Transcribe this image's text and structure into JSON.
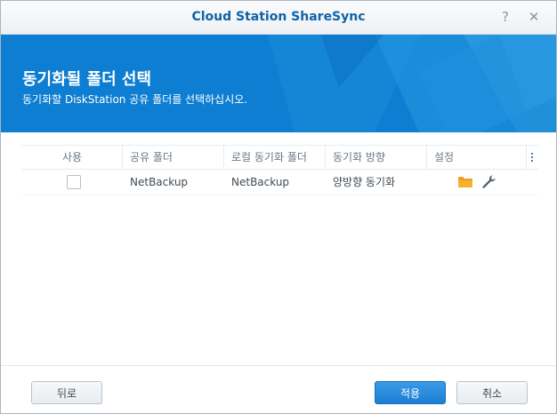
{
  "window": {
    "title": "Cloud Station ShareSync",
    "help_glyph": "?",
    "close_glyph": "✕"
  },
  "banner": {
    "title": "동기화될 폴더 선택",
    "subtitle": "동기화할 DiskStation 공유 폴더를 선택하십시오.",
    "color": "#0d7ed1"
  },
  "grid": {
    "columns": [
      "사용",
      "공유 폴더",
      "로컬 동기화 폴더",
      "동기화 방향",
      "설정"
    ],
    "rows": [
      {
        "enabled": false,
        "shared_folder": "NetBackup",
        "local_folder": "NetBackup",
        "direction": "양방향 동기화",
        "settings_icons": [
          "folder-icon",
          "wrench-icon"
        ]
      }
    ]
  },
  "footer": {
    "back_label": "뒤로",
    "apply_label": "적용",
    "cancel_label": "취소",
    "accent_color": "#1b7fd2"
  }
}
